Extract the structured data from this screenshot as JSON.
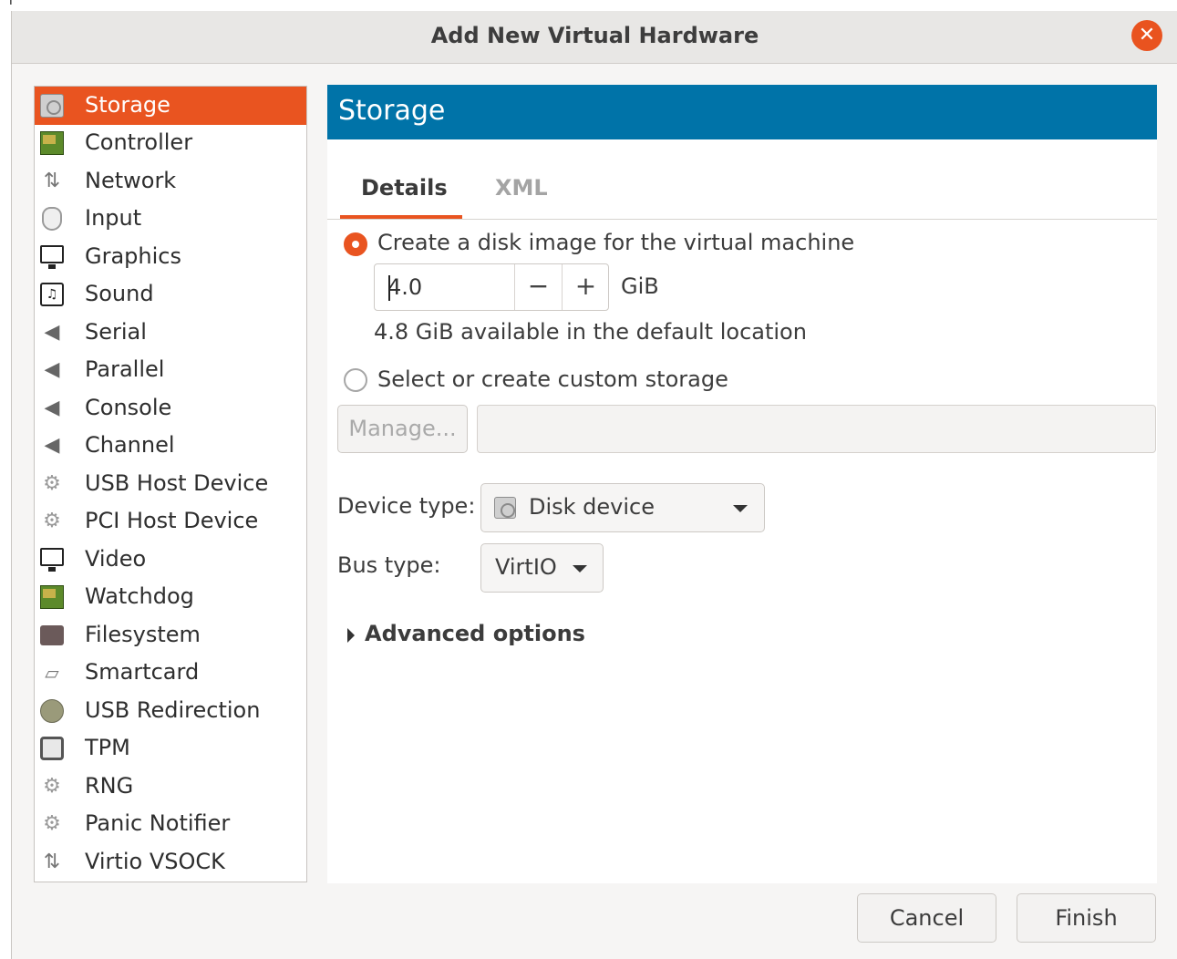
{
  "window": {
    "title": "Add New Virtual Hardware"
  },
  "sidebar": {
    "items": [
      {
        "label": "Storage",
        "icon": "hard-disk-icon",
        "selected": true
      },
      {
        "label": "Controller",
        "icon": "pci-card-icon"
      },
      {
        "label": "Network",
        "icon": "network-icon"
      },
      {
        "label": "Input",
        "icon": "mouse-icon"
      },
      {
        "label": "Graphics",
        "icon": "monitor-icon"
      },
      {
        "label": "Sound",
        "icon": "sound-icon"
      },
      {
        "label": "Serial",
        "icon": "serial-port-icon"
      },
      {
        "label": "Parallel",
        "icon": "parallel-port-icon"
      },
      {
        "label": "Console",
        "icon": "console-port-icon"
      },
      {
        "label": "Channel",
        "icon": "channel-port-icon"
      },
      {
        "label": "USB Host Device",
        "icon": "gears-icon"
      },
      {
        "label": "PCI Host Device",
        "icon": "gears-icon"
      },
      {
        "label": "Video",
        "icon": "monitor-icon"
      },
      {
        "label": "Watchdog",
        "icon": "pci-card-icon"
      },
      {
        "label": "Filesystem",
        "icon": "folder-icon"
      },
      {
        "label": "Smartcard",
        "icon": "smartcard-icon"
      },
      {
        "label": "USB Redirection",
        "icon": "usb-icon"
      },
      {
        "label": "TPM",
        "icon": "chip-icon"
      },
      {
        "label": "RNG",
        "icon": "gears-icon"
      },
      {
        "label": "Panic Notifier",
        "icon": "gears-icon"
      },
      {
        "label": "Virtio VSOCK",
        "icon": "network-icon"
      }
    ]
  },
  "panel": {
    "header": "Storage",
    "tabs": [
      {
        "label": "Details",
        "active": true
      },
      {
        "label": "XML",
        "active": false
      }
    ],
    "create_disk_label": "Create a disk image for the virtual machine",
    "size_value": "4.0",
    "size_unit": "GiB",
    "available_text": "4.8 GiB available in the default location",
    "custom_storage_label": "Select or create custom storage",
    "manage_label": "Manage...",
    "storage_path": "",
    "device_type_label": "Device type:",
    "device_type_value": "Disk device",
    "bus_type_label": "Bus type:",
    "bus_type_value": "VirtIO",
    "advanced_label": "Advanced options"
  },
  "footer": {
    "cancel_label": "Cancel",
    "finish_label": "Finish"
  },
  "colors": {
    "accent": "#e95420",
    "header_blue": "#0073a8"
  }
}
